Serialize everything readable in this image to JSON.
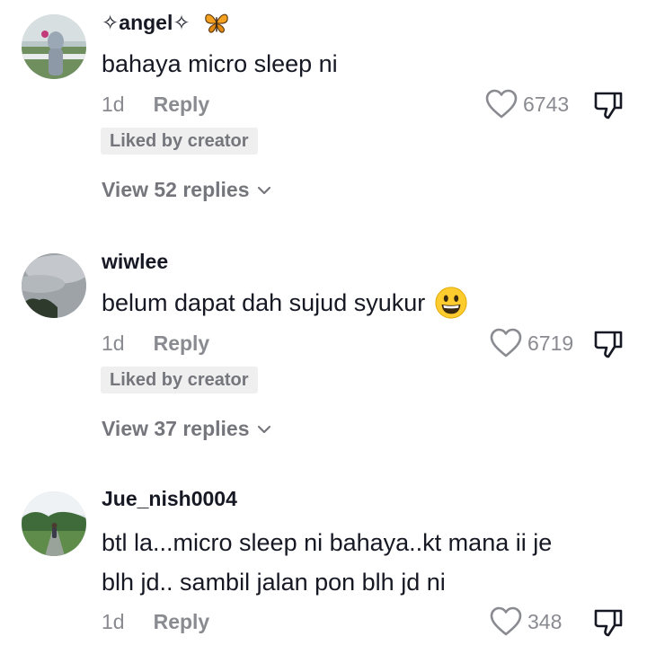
{
  "comments": [
    {
      "username": "✧angel✧",
      "username_emoji": "butterfly-icon",
      "text_lines": [
        "bahaya micro sleep ni"
      ],
      "age": "1d",
      "reply_label": "Reply",
      "likes": "6743",
      "badge": "Liked by creator",
      "view_replies": "View 52 replies"
    },
    {
      "username": "wiwlee",
      "text_lines": [
        "belum dapat dah sujud syukur"
      ],
      "text_emoji": "grinning-face-emoji",
      "age": "1d",
      "reply_label": "Reply",
      "likes": "6719",
      "badge": "Liked by creator",
      "view_replies": "View 37 replies"
    },
    {
      "username": "Jue_nish0004",
      "text_lines": [
        "btl la...micro sleep ni bahaya..kt mana ii je",
        "blh jd.. sambil jalan pon blh jd ni"
      ],
      "age": "1d",
      "reply_label": "Reply",
      "likes": "348"
    }
  ],
  "colors": {
    "text_primary": "#161823",
    "text_secondary": "#8a8b91",
    "badge_bg": "#efeff0"
  }
}
